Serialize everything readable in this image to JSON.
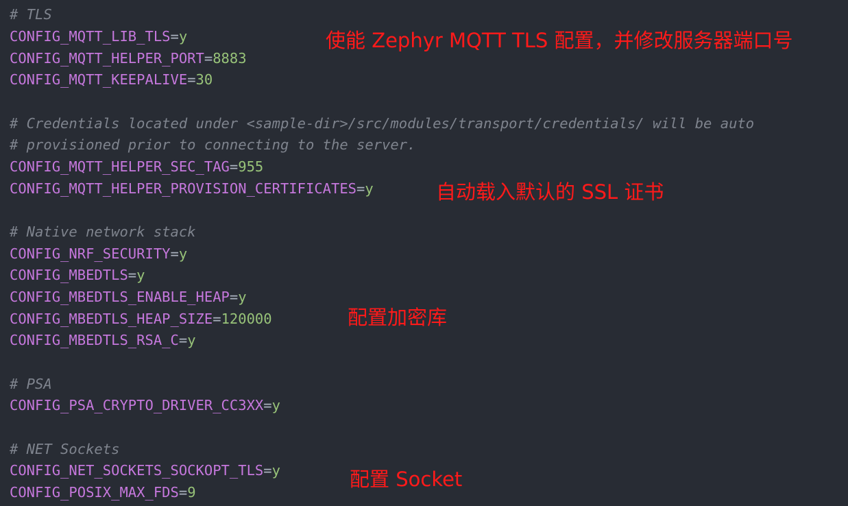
{
  "lines": [
    {
      "type": "comment",
      "text": "# TLS"
    },
    {
      "type": "kv",
      "key": "CONFIG_MQTT_LIB_TLS",
      "eq": "=",
      "value": "y"
    },
    {
      "type": "kv",
      "key": "CONFIG_MQTT_HELPER_PORT",
      "eq": "=",
      "value": "8883"
    },
    {
      "type": "kv",
      "key": "CONFIG_MQTT_KEEPALIVE",
      "eq": "=",
      "value": "30"
    },
    {
      "type": "blank",
      "text": ""
    },
    {
      "type": "comment",
      "text": "# Credentials located under <sample-dir>/src/modules/transport/credentials/ will be auto"
    },
    {
      "type": "comment",
      "text": "# provisioned prior to connecting to the server."
    },
    {
      "type": "kv",
      "key": "CONFIG_MQTT_HELPER_SEC_TAG",
      "eq": "=",
      "value": "955"
    },
    {
      "type": "kv",
      "key": "CONFIG_MQTT_HELPER_PROVISION_CERTIFICATES",
      "eq": "=",
      "value": "y"
    },
    {
      "type": "blank",
      "text": ""
    },
    {
      "type": "comment",
      "text": "# Native network stack"
    },
    {
      "type": "kv",
      "key": "CONFIG_NRF_SECURITY",
      "eq": "=",
      "value": "y"
    },
    {
      "type": "kv",
      "key": "CONFIG_MBEDTLS",
      "eq": "=",
      "value": "y"
    },
    {
      "type": "kv",
      "key": "CONFIG_MBEDTLS_ENABLE_HEAP",
      "eq": "=",
      "value": "y"
    },
    {
      "type": "kv",
      "key": "CONFIG_MBEDTLS_HEAP_SIZE",
      "eq": "=",
      "value": "120000"
    },
    {
      "type": "kv",
      "key": "CONFIG_MBEDTLS_RSA_C",
      "eq": "=",
      "value": "y"
    },
    {
      "type": "blank",
      "text": ""
    },
    {
      "type": "comment",
      "text": "# PSA"
    },
    {
      "type": "kv",
      "key": "CONFIG_PSA_CRYPTO_DRIVER_CC3XX",
      "eq": "=",
      "value": "y"
    },
    {
      "type": "blank",
      "text": ""
    },
    {
      "type": "comment",
      "text": "# NET Sockets"
    },
    {
      "type": "kv",
      "key": "CONFIG_NET_SOCKETS_SOCKOPT_TLS",
      "eq": "=",
      "value": "y"
    },
    {
      "type": "kv",
      "key": "CONFIG_POSIX_MAX_FDS",
      "eq": "=",
      "value": "9"
    }
  ],
  "annotations": {
    "mqtt_tls": "使能 Zephyr MQTT TLS 配置，并修改服务器端口号",
    "ssl_cert": "自动载入默认的 SSL 证书",
    "crypto_lib": "配置加密库",
    "socket": "配置 Socket"
  },
  "colors": {
    "background": "#282c34",
    "key": "#c678dd",
    "value": "#98c379",
    "comment": "#7f848e",
    "annotation": "#ff1a1a"
  }
}
